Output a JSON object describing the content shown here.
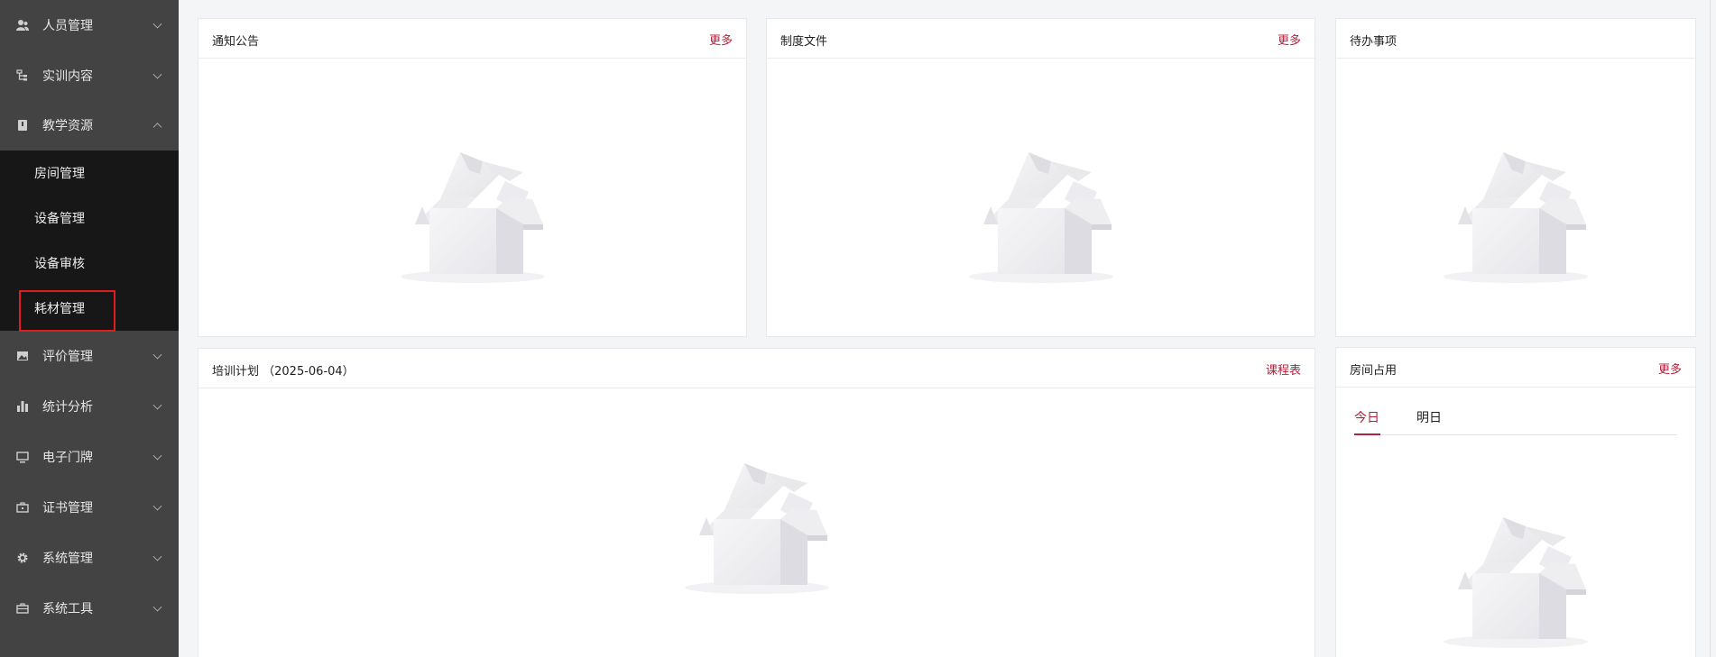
{
  "sidebar": {
    "items": [
      {
        "label": "人员管理",
        "icon": "user-group-icon"
      },
      {
        "label": "实训内容",
        "icon": "tree-icon"
      },
      {
        "label": "教学资源",
        "icon": "book-icon"
      },
      {
        "label": "评价管理",
        "icon": "image-icon"
      },
      {
        "label": "统计分析",
        "icon": "bar-chart-icon"
      },
      {
        "label": "电子门牌",
        "icon": "monitor-icon"
      },
      {
        "label": "证书管理",
        "icon": "briefcase-icon"
      },
      {
        "label": "系统管理",
        "icon": "gear-icon"
      },
      {
        "label": "系统工具",
        "icon": "toolbox-icon"
      }
    ],
    "submenu": [
      {
        "label": "房间管理"
      },
      {
        "label": "设备管理"
      },
      {
        "label": "设备审核"
      },
      {
        "label": "耗材管理"
      }
    ]
  },
  "panels": {
    "notice": {
      "title": "通知公告",
      "more": "更多"
    },
    "policy": {
      "title": "制度文件",
      "more": "更多"
    },
    "todo": {
      "title": "待办事项"
    },
    "training": {
      "title": "培训计划 （2025-06-04）",
      "more": "课程表"
    },
    "room": {
      "title": "房间占用",
      "more": "更多",
      "tabs": [
        "今日",
        "明日"
      ]
    }
  },
  "colors": {
    "sidebar_bg": "#434343",
    "submenu_bg": "#171717",
    "accent": "#b3203a",
    "highlight_box": "#e11c1c",
    "page_bg": "#f4f5f7"
  }
}
